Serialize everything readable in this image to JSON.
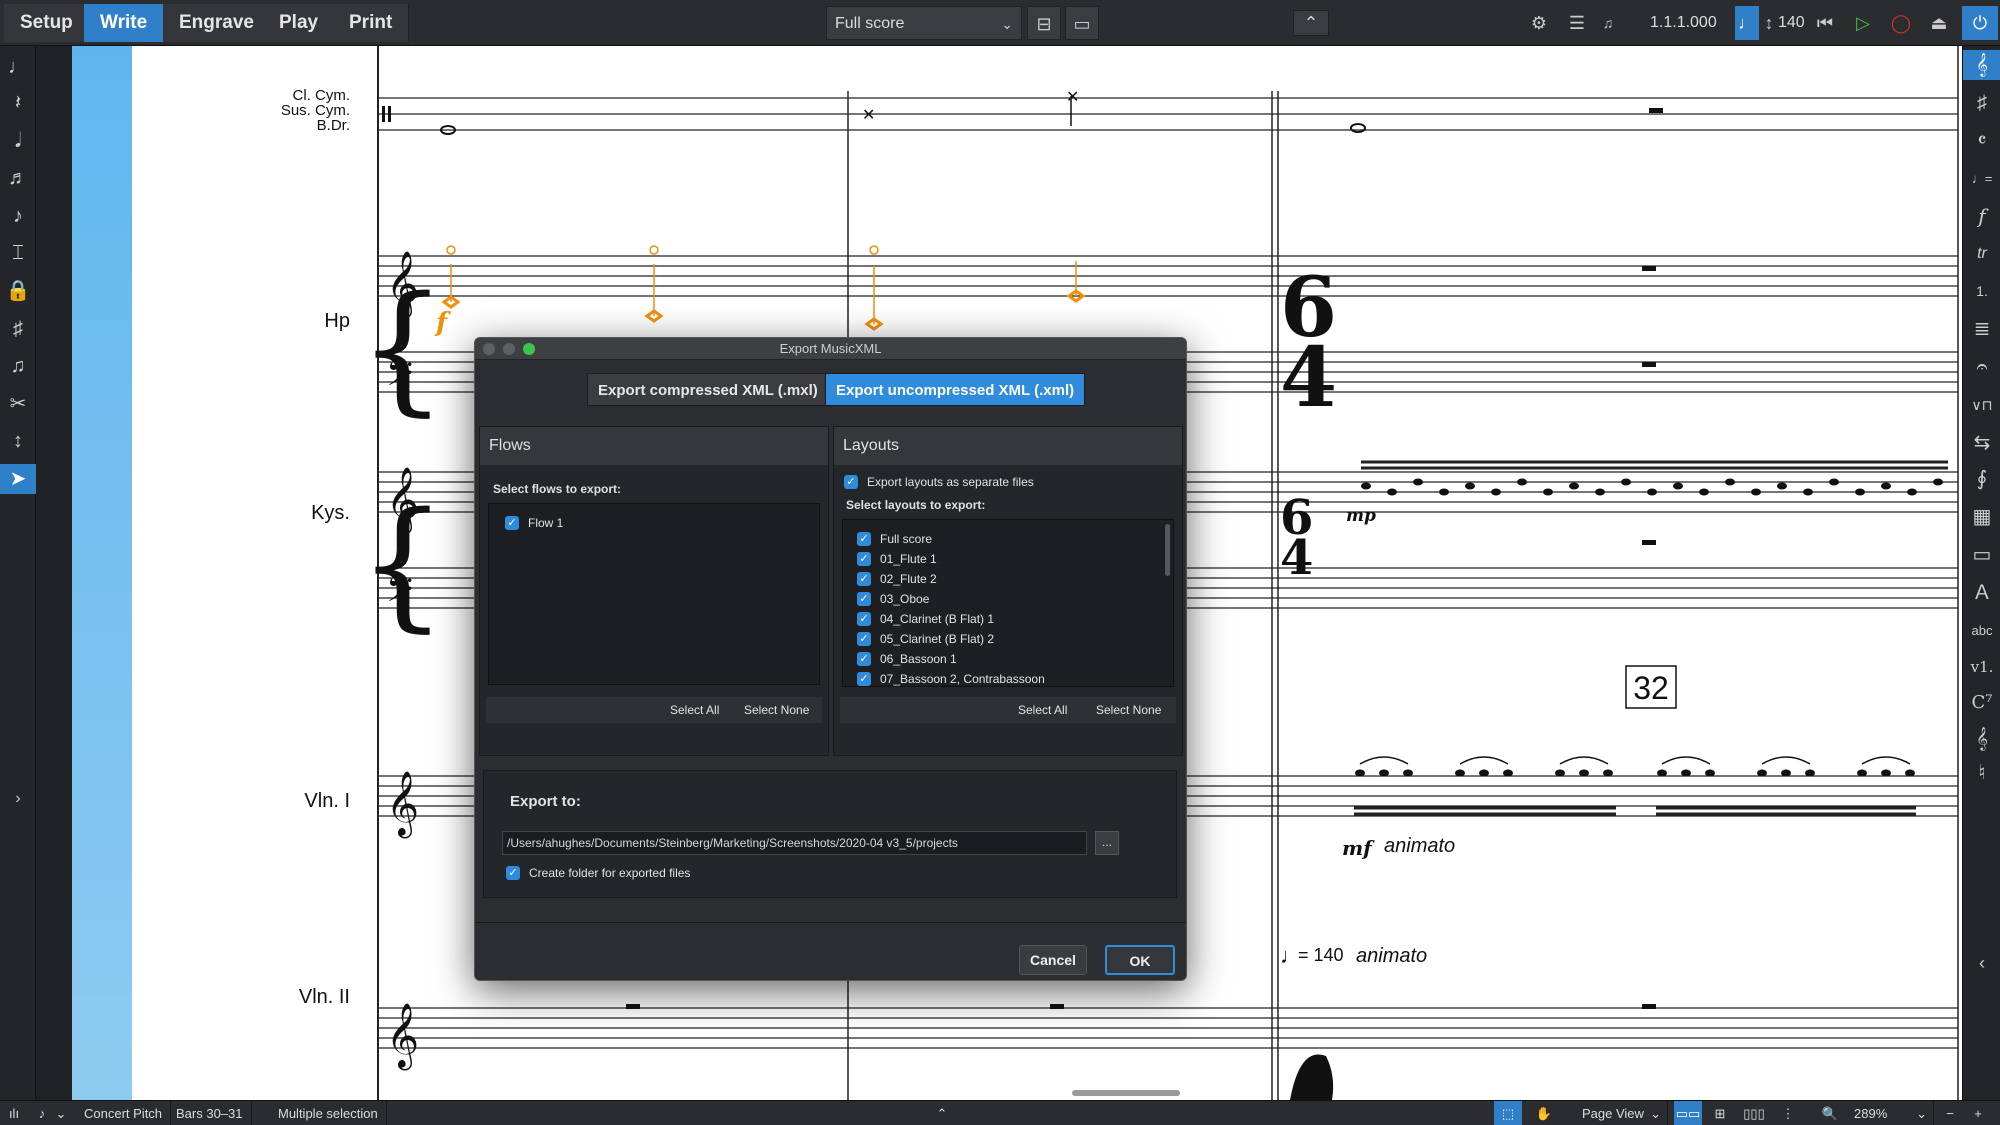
{
  "toolbar": {
    "modes": [
      "Setup",
      "Write",
      "Engrave",
      "Play",
      "Print"
    ],
    "active_mode": "Write",
    "layout_selector": "Full score",
    "position": "1.1.1.000",
    "tempo": "140"
  },
  "score": {
    "instruments": [
      {
        "line1": "Cl. Cym.",
        "line2": "Sus. Cym.",
        "line3": "B.Dr."
      },
      {
        "name": "Hp"
      },
      {
        "name": "Kys."
      },
      {
        "name": "Vln. I"
      },
      {
        "name": "Vln. II"
      }
    ],
    "rehearsal_mark": "32",
    "dynamics": {
      "harp": "f",
      "keys": "mp",
      "violin": "mf"
    },
    "violin_expression": "animato",
    "tempo_marking": "= 140",
    "tempo_text": "animato",
    "time_signature": {
      "numerator": "6",
      "denominator": "4"
    }
  },
  "dialog": {
    "title": "Export MusicXML",
    "tabs": [
      "Export compressed XML (.mxl)",
      "Export uncompressed XML (.xml)"
    ],
    "active_tab": "Export uncompressed XML (.xml)",
    "flows": {
      "heading": "Flows",
      "sublabel": "Select flows to export:",
      "items": [
        "Flow 1"
      ],
      "select_all": "Select All",
      "select_none": "Select None"
    },
    "layouts": {
      "heading": "Layouts",
      "separate_files_label": "Export layouts as separate files",
      "sublabel": "Select layouts to export:",
      "items": [
        "Full score",
        "01_Flute 1",
        "02_Flute 2",
        "03_Oboe",
        "04_Clarinet (B Flat) 1",
        "05_Clarinet (B Flat) 2",
        "06_Bassoon 1",
        "07_Bassoon 2, Contrabassoon"
      ],
      "select_all": "Select All",
      "select_none": "Select None"
    },
    "export_to": {
      "label": "Export to:",
      "path": "/Users/ahughes/Documents/Steinberg/Marketing/Screenshots/2020-04 v3_5/projects",
      "browse": "...",
      "create_folder_label": "Create folder for exported files"
    },
    "cancel": "Cancel",
    "ok": "OK"
  },
  "statusbar": {
    "concert_pitch": "Concert Pitch",
    "bars": "Bars 30–31",
    "selection": "Multiple selection",
    "view": "Page View",
    "zoom": "289%"
  },
  "colors": {
    "accent": "#2f8bdc",
    "selection": "#f0900c"
  }
}
